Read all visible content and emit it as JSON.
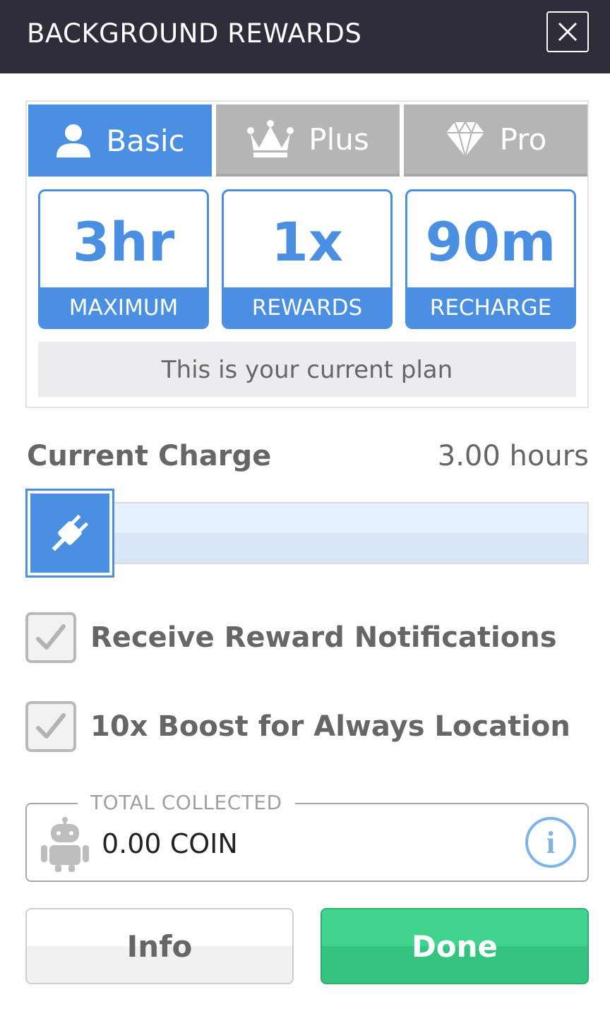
{
  "header": {
    "title": "BACKGROUND REWARDS",
    "close_icon": "close-icon"
  },
  "plans": {
    "tabs": [
      {
        "label": "Basic",
        "icon": "user-icon",
        "selected": true
      },
      {
        "label": "Plus",
        "icon": "crown-icon",
        "selected": false
      },
      {
        "label": "Pro",
        "icon": "diamond-icon",
        "selected": false
      }
    ],
    "stats": [
      {
        "value": "3hr",
        "label": "MAXIMUM"
      },
      {
        "value": "1x",
        "label": "REWARDS"
      },
      {
        "value": "90m",
        "label": "RECHARGE"
      }
    ],
    "current_plan_text": "This is your current plan"
  },
  "charge": {
    "label": "Current Charge",
    "value": "3.00 hours",
    "icon": "plug-icon"
  },
  "options": [
    {
      "label": "Receive Reward Notifications",
      "checked": true
    },
    {
      "label": "10x Boost for Always Location",
      "checked": true
    }
  ],
  "collected": {
    "legend": "TOTAL COLLECTED",
    "value": "0.00 COIN",
    "icon": "robot-icon",
    "info_icon": "info-icon"
  },
  "buttons": {
    "info_label": "Info",
    "done_label": "Done"
  },
  "colors": {
    "header_bg": "#2f2d39",
    "accent_blue": "#4a8fe2",
    "inactive_tab": "#b5b5b5",
    "done_green": "#3ccb86"
  }
}
